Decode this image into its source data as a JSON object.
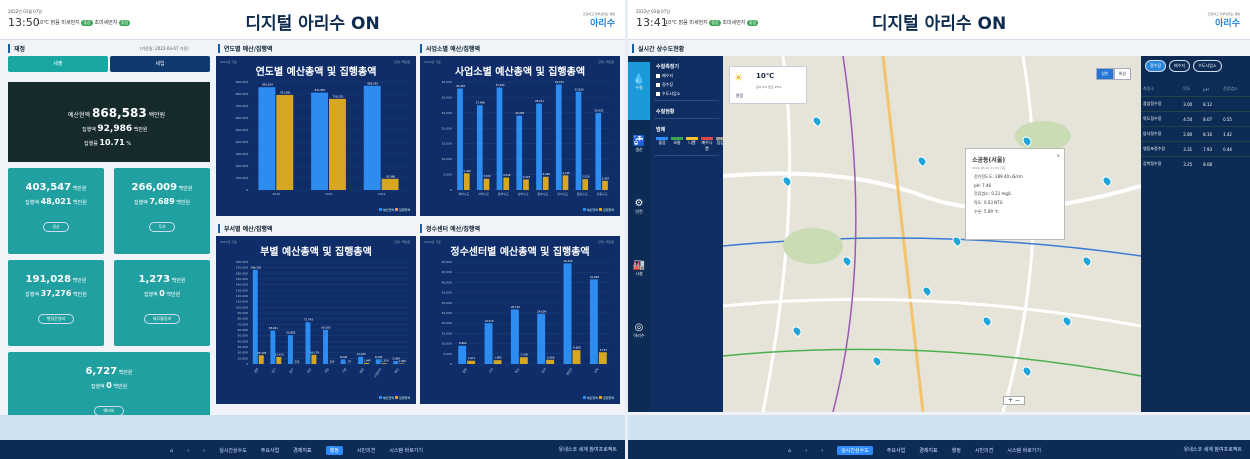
{
  "left": {
    "header": {
      "date": "2022년 03월 07일",
      "time": "13:50",
      "temp": "10℃",
      "weather": "맑음",
      "dust_label": "미세먼지",
      "dust_status": "좋음",
      "ultra_label": "초미세먼지",
      "ultra_status": "좋음",
      "title": "디지털 아리수 ON",
      "logo_small": "건강하고 자부심있는 생활",
      "logo_main": "아리수"
    },
    "finance": {
      "section": "재정",
      "base_date": "(기준일: 2022-03-07 기준)",
      "tab_revenue": "세출",
      "tab_income": "세입",
      "budget_label": "예산현액",
      "budget_value": "868,583",
      "unit": "백만원",
      "exec_label": "집행액",
      "exec_value": "92,986",
      "rate_label": "집행률",
      "rate_value": "10.71",
      "rate_unit": "%",
      "cards": [
        {
          "value": "403,547",
          "exec": "48,021",
          "button": "경상"
        },
        {
          "value": "266,009",
          "exec": "7,689",
          "button": "투자"
        },
        {
          "value": "191,028",
          "exec": "37,276",
          "button": "행정운영비"
        },
        {
          "value": "1,273",
          "exec": "0",
          "button": "재무활동비"
        },
        {
          "value": "6,727",
          "exec": "0",
          "button": "예비비"
        }
      ]
    },
    "panels": {
      "year_section": "연도별 예산/집행액",
      "biz_section": "사업소별 예산/집행액",
      "dept_section": "부서별 예산/집행액",
      "center_section": "정수센터 예산/집행액",
      "unit_text": "단위: 백만원",
      "small_date": "2022년 기준",
      "legend_budget": "예산현액",
      "legend_exec": "집행현액"
    },
    "footer": {
      "items": [
        "실시간상수도",
        "주요사업",
        "경제지표",
        "행정",
        "시민의견",
        "시스템 바로가기"
      ],
      "active": "행정",
      "right": "유네스코 세계 참여프로젝트"
    }
  },
  "chart_data": [
    {
      "type": "bar",
      "title": "연도별 예산총액 및 집행총액",
      "categories": [
        "2020",
        "2021",
        "2022"
      ],
      "ylim": [
        0,
        900000
      ],
      "yticks": [
        "0",
        "100,000",
        "200,000",
        "300,000",
        "400,000",
        "500,000",
        "600,000",
        "700,000",
        "800,000",
        "900,000"
      ],
      "series": [
        {
          "name": "예산현액",
          "color": "#2d8cf0",
          "values": [
            856584,
            811807,
            868583
          ]
        },
        {
          "name": "집행현액",
          "color": "#d8a722",
          "values": [
            791981,
            759220,
            92986
          ]
        }
      ]
    },
    {
      "type": "bar",
      "title": "사업소별 예산총액 및 집행총액",
      "categories": [
        "북부수도",
        "서부수도",
        "동부수도",
        "남부수도",
        "중부수도",
        "강서수도",
        "동남수도",
        "강동수도"
      ],
      "ylim": [
        0,
        35000
      ],
      "yticks": [
        "0",
        "5,000",
        "10,000",
        "15,000",
        "20,000",
        "25,000",
        "30,000",
        "35,000"
      ],
      "series": [
        {
          "name": "예산현액",
          "color": "#2d8cf0",
          "values": [
            32903,
            27466,
            33204,
            24084,
            28011,
            34193,
            31830,
            24935
          ]
        },
        {
          "name": "집행현액",
          "color": "#d8a722",
          "values": [
            5426,
            3672,
            4046,
            3423,
            4296,
            4745,
            3519,
            2987
          ]
        }
      ]
    },
    {
      "type": "bar",
      "title": "부별 예산총액 및 집행총액",
      "categories": [
        "경영",
        "정수",
        "급수",
        "생산",
        "사업",
        "시설",
        "총괄",
        "시설관리",
        "예산"
      ],
      "ylim": [
        0,
        180000
      ],
      "yticks": [
        "0",
        "10,000",
        "20,000",
        "30,000",
        "40,000",
        "50,000",
        "60,000",
        "70,000",
        "80,000",
        "90,000",
        "100,000",
        "110,000",
        "120,000",
        "130,000",
        "140,000",
        "150,000",
        "160,000",
        "170,000",
        "180,000"
      ],
      "series": [
        {
          "name": "예산현액",
          "color": "#2d8cf0",
          "values": [
            166102,
            58941,
            50882,
            73743,
            60305,
            8000,
            12940,
            8265,
            5000
          ]
        },
        {
          "name": "집행현액",
          "color": "#d8a722",
          "values": [
            15326,
            12412,
            326,
            16178,
            324,
            97,
            1945,
            1359,
            1000
          ]
        }
      ]
    },
    {
      "type": "bar",
      "title": "정수센터별 예산총액 및 집행총액",
      "categories": [
        "광암",
        "구의",
        "뚝도",
        "암사",
        "영등포",
        "강북"
      ],
      "ylim": [
        0,
        50000
      ],
      "yticks": [
        "0",
        "5,000",
        "10,000",
        "15,000",
        "20,000",
        "25,000",
        "30,000",
        "35,000",
        "40,000",
        "45,000",
        "50,000"
      ],
      "series": [
        {
          "name": "예산현액",
          "color": "#2d8cf0",
          "values": [
            8960,
            19970,
            26744,
            24609,
            49324,
            41468
          ]
        },
        {
          "name": "집행현액",
          "color": "#d8a722",
          "values": [
            1611,
            1885,
            3336,
            2068,
            6808,
            5757
          ]
        }
      ]
    }
  ],
  "right": {
    "header": {
      "date": "2022년 03월 07일",
      "time": "13:41",
      "temp": "10℃",
      "weather": "맑음",
      "dust_label": "미세먼지",
      "dust_status": "좋음",
      "ultra_label": "초미세먼지",
      "ultra_status": "좋음",
      "title": "디지털 아리수 ON",
      "logo_small": "건강하고 자부심있는 생활",
      "logo_main": "아리수"
    },
    "section": "실시간 상수도현황",
    "sidebar": [
      "수질",
      "생산",
      "안전",
      "시설",
      "아리수"
    ],
    "lpanel": {
      "h1": "수질측정기",
      "checks": [
        "배수지",
        "정수장",
        "수도사업소"
      ],
      "h2": "수질현황",
      "h3": "범례",
      "legend": [
        "좋음",
        "보통",
        "나쁨",
        "매우나쁨",
        "점검중"
      ]
    },
    "weather_card": {
      "temp": "10℃",
      "status": "맑음",
      "detail": "강수 0% 습도 25%"
    },
    "map_ctl": [
      "일반",
      "위성"
    ],
    "popup": {
      "title": "소공동(서울)",
      "date": "2022-03-01 11:50 기준",
      "rows": [
        "전기전도도: 289.40 uS/cm",
        "pH: 7.46",
        "잔류염소: 0.21 mg/L",
        "탁도: 0.03 NTU",
        "수온: 5.09 ℃"
      ]
    },
    "rpanel": {
      "tabs": [
        "정수장",
        "배수지",
        "수도사업소"
      ],
      "headers": [
        "측정소",
        "탁도",
        "pH",
        "잔류염소"
      ],
      "rows": [
        [
          "광암정수장",
          "3.00",
          "8.12",
          ""
        ],
        [
          "뚝도정수장",
          "4.50",
          "8.07",
          "0.55"
        ],
        [
          "암사정수장",
          "2.80",
          "8.16",
          "1.42"
        ],
        [
          "영등포정수장",
          "3.31",
          "7.93",
          "0.44"
        ],
        [
          "강북정수장",
          "3.25",
          "8.08",
          ""
        ]
      ]
    },
    "footer": {
      "items": [
        "실시간상수도",
        "주요사업",
        "경제지표",
        "행정",
        "시민의견",
        "시스템 바로가기"
      ],
      "active": "실시간상수도",
      "right": "유네스코 세계 참여프로젝트"
    }
  }
}
